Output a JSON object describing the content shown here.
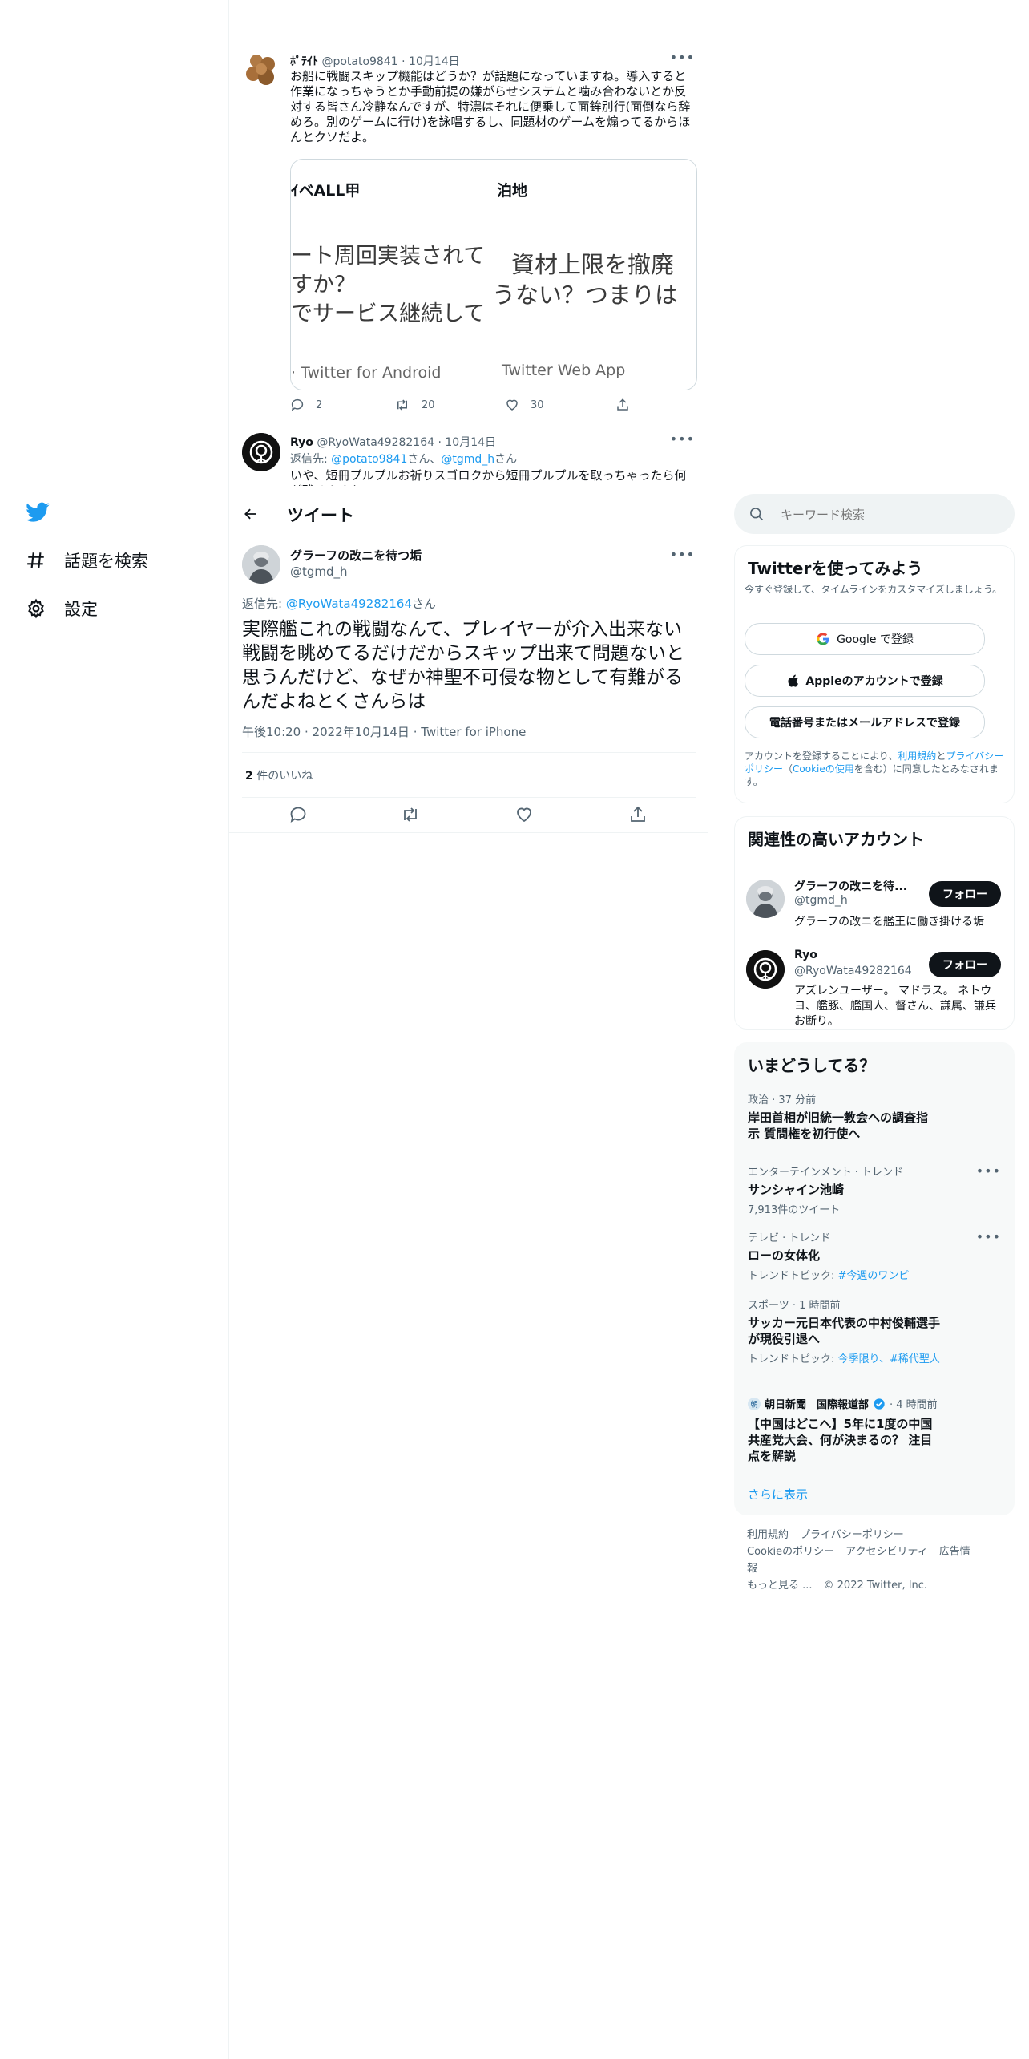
{
  "nav": {
    "explore_label": "話題を検索",
    "settings_label": "設定"
  },
  "thread_above": {
    "tweet1": {
      "name": "ﾎﾟﾃｲﾄ",
      "handle": "@potato9841",
      "date": "10月14日",
      "text": "お船に戦闘スキップ機能はどうか？が話題になっていますね。導入すると作業になっちゃうとか手動前提の嫌がらせシステムと噛み合わないとか反対する皆さん冷静なんですが、特濃はそれに便乗して面鉾別行(面倒なら辞めろ。別のゲームに行け)を詠唱するし、同題材のゲームを煽ってるからほんとクソだよ。",
      "image_left": {
        "header": "ｲベALL甲",
        "line1": "ート周回実装されて",
        "line2": "すか？",
        "line3": "でサービス継続して",
        "footer": "· Twitter for Android"
      },
      "image_right": {
        "header": "泊地",
        "line1": "資材上限を撤廃",
        "line2": "うない？つまりは",
        "footer": "Twitter Web App"
      },
      "replies": "2",
      "retweets": "20",
      "likes": "30"
    },
    "tweet2": {
      "name": "Ryo",
      "handle": "@RyoWata49282164",
      "date": "10月14日",
      "reply_prefix": "返信先: ",
      "reply_to1": "@potato9841",
      "reply_mid": "さん、",
      "reply_to2": "@tgmd_h",
      "reply_suffix": "さん",
      "text": "いや、短冊プルプルお祈りスゴロクから短冊プルプルを取っちゃったら何が残るんすか"
    }
  },
  "header": {
    "title": "ツイート"
  },
  "main_tweet": {
    "name": "グラーフの改ニを待つ垢",
    "handle": "@tgmd_h",
    "reply_prefix": "返信先: ",
    "reply_to": "@RyoWata49282164",
    "reply_suffix": "さん",
    "text": "実際艦これの戦闘なんて、プレイヤーが介入出来ない戦闘を眺めてるだけだからスキップ出来て問題ないと思うんだけど、なぜか神聖不可侵な物として有難がるんだよねとくさんらは",
    "time": "午後10:20",
    "date": "2022年10月14日",
    "source": "Twitter for iPhone",
    "likes_count": "2",
    "likes_label": "件のいいね"
  },
  "search": {
    "placeholder": "キーワード検索"
  },
  "signup": {
    "title": "Twitterを使ってみよう",
    "desc": "今すぐ登録して、タイムラインをカスタマイズしましょう。",
    "google_label": "Google で登録",
    "apple_label": "Appleのアカウントで登録",
    "phone_label": "電話番号またはメールアドレスで登録",
    "terms_prefix": "アカウントを登録することにより、",
    "terms_link1": "利用規約",
    "terms_mid1": "と",
    "terms_link2": "プライバシーポリシー",
    "terms_mid2": "（",
    "terms_link3": "Cookieの使用",
    "terms_suffix": "を含む）に同意したとみなされます。"
  },
  "related": {
    "title": "関連性の高いアカウント",
    "accounts": [
      {
        "name": "グラーフの改ニを待...",
        "handle": "@tgmd_h",
        "bio": "グラーフの改ニを艦王に働き掛ける垢",
        "follow_label": "フォロー"
      },
      {
        "name": "Ryo",
        "handle": "@RyoWata49282164",
        "bio": "アズレンユーザー。 マドラス。 ネトウヨ、艦豚、艦国人、督さん、謙属、謙兵お断り。",
        "follow_label": "フォロー"
      }
    ]
  },
  "trends": {
    "title": "いまどうしてる？",
    "items": [
      {
        "meta": "政治 · 37 分前",
        "title": "岸田首相が旧統一教会への調査指示 質問権を初行使へ"
      },
      {
        "meta": "エンターテインメント · トレンド",
        "title": "サンシャイン池崎",
        "sub": "7,913件のツイート"
      },
      {
        "meta": "テレビ · トレンド",
        "title": "ローの女体化",
        "sub_prefix": "トレンドトピック: ",
        "sub_link": "#今週のワンピ"
      },
      {
        "meta": "スポーツ · 1 時間前",
        "title": "サッカー元日本代表の中村俊輔選手が現役引退へ",
        "sub_prefix": "トレンドトピック: ",
        "sub_link": "今季限り、#稀代聖人"
      },
      {
        "source": "朝日新聞　国際報道部",
        "meta": "· 4 時間前",
        "title": "【中国はどこへ】5年に1度の中国共産党大会、何が決まるの？ 注目点を解説"
      }
    ],
    "show_more": "さらに表示"
  },
  "footer": {
    "links": [
      "利用規約",
      "プライバシーポリシー",
      "Cookieのポリシー",
      "アクセシビリティ",
      "広告情報",
      "もっと見る ..."
    ],
    "copyright": "© 2022 Twitter, Inc."
  },
  "colors": {
    "accent": "#1d9bf0",
    "text": "#0f1419",
    "muted": "#536471",
    "border": "#eff3f4"
  }
}
